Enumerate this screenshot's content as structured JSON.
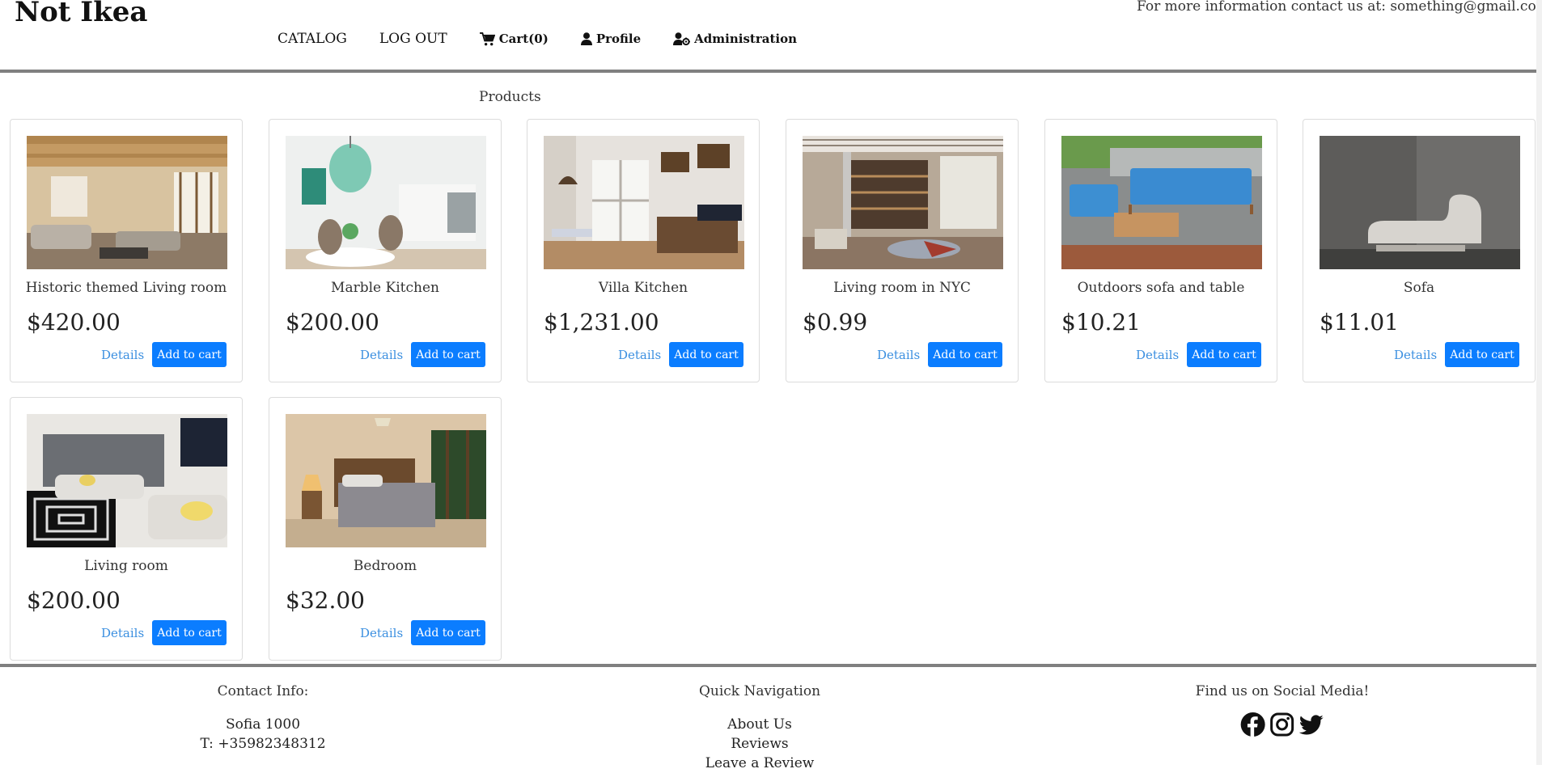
{
  "header": {
    "brand": "Not Ikea",
    "contact_text": "For more information contact us at: something@gmail.com",
    "nav": {
      "catalog": "CATALOG",
      "logout": "LOG OUT",
      "cart": "Cart(0)",
      "profile": "Profile",
      "administration": "Administration"
    },
    "icons": [
      "cart-icon",
      "user-icon",
      "user-cog-icon"
    ]
  },
  "main": {
    "title": "Products",
    "details_label": "Details",
    "add_label": "Add to cart",
    "accent_color": "#0b7dff",
    "products": [
      {
        "name": "Historic themed Living room",
        "price": "$420.00"
      },
      {
        "name": "Marble Kitchen",
        "price": "$200.00"
      },
      {
        "name": "Villa Kitchen",
        "price": "$1,231.00"
      },
      {
        "name": "Living room in NYC",
        "price": "$0.99"
      },
      {
        "name": "Outdoors sofa and table",
        "price": "$10.21"
      },
      {
        "name": "Sofa",
        "price": "$11.01"
      },
      {
        "name": "Living room",
        "price": "$200.00"
      },
      {
        "name": "Bedroom",
        "price": "$32.00"
      }
    ]
  },
  "footer": {
    "contact": {
      "heading": "Contact Info:",
      "address": "Sofia 1000",
      "phone": "T: +35982348312"
    },
    "quick_nav": {
      "heading": "Quick Navigation",
      "links": [
        "About Us",
        "Reviews",
        "Leave a Review"
      ]
    },
    "social": {
      "heading": "Find us on Social Media!",
      "icons": [
        "facebook-icon",
        "instagram-icon",
        "twitter-icon"
      ]
    }
  }
}
